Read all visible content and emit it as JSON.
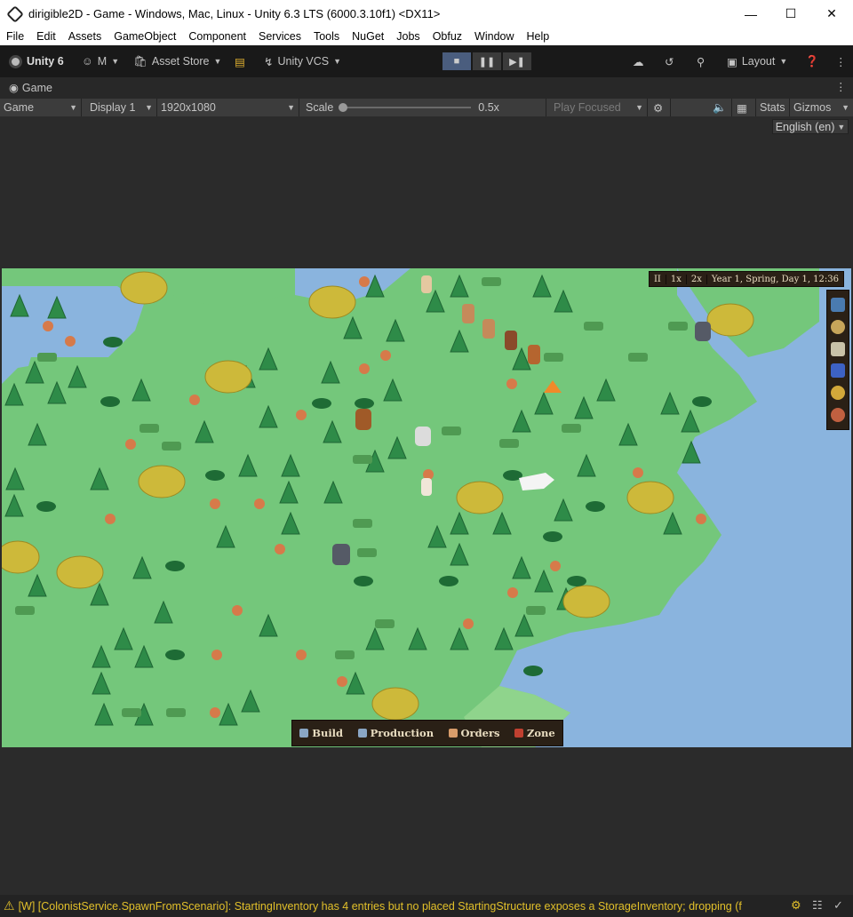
{
  "window": {
    "title": "dirigible2D - Game - Windows, Mac, Linux - Unity 6.3 LTS (6000.3.10f1) <DX11>",
    "minimize_icon": "minimize-icon",
    "maximize_icon": "maximize-icon",
    "close_icon": "close-icon"
  },
  "menu": [
    "File",
    "Edit",
    "Assets",
    "GameObject",
    "Component",
    "Services",
    "Tools",
    "NuGet",
    "Jobs",
    "Obfuz",
    "Window",
    "Help"
  ],
  "toolbar": {
    "unity_label": "Unity 6",
    "account_label": "M",
    "asset_store_label": "Asset Store",
    "vcs_label": "Unity VCS",
    "layout_label": "Layout"
  },
  "tab": {
    "label": "Game"
  },
  "gamebar": {
    "view_select": "Game",
    "display_select": "Display 1",
    "resolution_select": "1920x1080",
    "scale_label": "Scale",
    "scale_value": "0.5x",
    "play_mode_select": "Play Focused",
    "stats_label": "Stats",
    "gizmos_label": "Gizmos"
  },
  "language_select": "English (en)",
  "game": {
    "hud_pause": "II",
    "hud_speed1": "1x",
    "hud_speed2": "2x",
    "hud_date": "Year 1, Spring, Day 1, 12:36",
    "actions": [
      "Build",
      "Production",
      "Orders",
      "Zone"
    ]
  },
  "console": {
    "message": "[W] [ColonistService.SpawnFromScenario]: StartingInventory has 4 entries but no placed StartingStructure exposes a StorageInventory; dropping (f"
  },
  "colors": {
    "grass": "#74c77b",
    "water": "#8ab4de",
    "tree": "#2e8b48",
    "play_active": "#4a5d7e",
    "warning": "#e2c02a"
  }
}
